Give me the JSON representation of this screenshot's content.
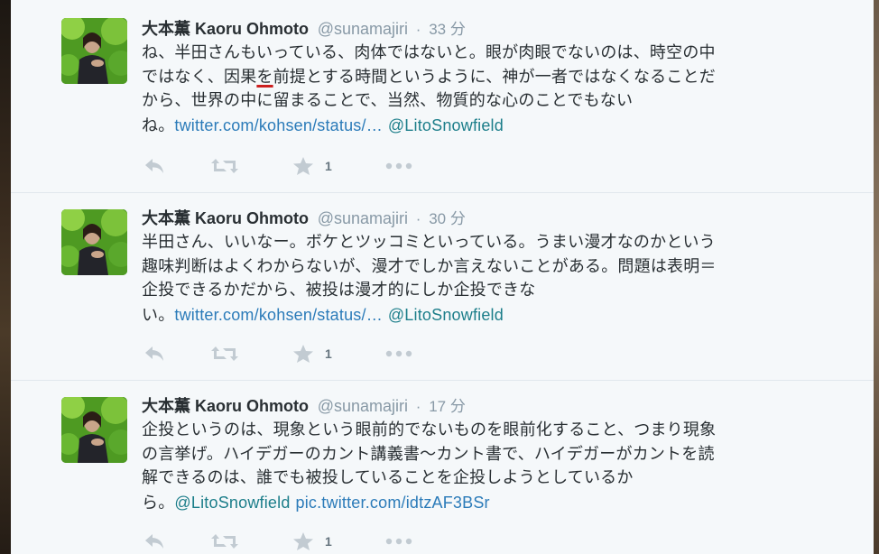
{
  "tweets": [
    {
      "fullname": "大本薫 Kaoru Ohmoto",
      "username": "@sunamajiri",
      "dot": "·",
      "time": "33 分",
      "lines": [
        {
          "a": "ね、半田さんもいっている、肉体ではないと。眼が肉眼でないのは、時空の中"
        },
        {
          "a": "ではなく、因果",
          "typo": "を",
          "b": "前提とする時間というように、神が一者ではなくなることだ"
        },
        {
          "a": "から、世界の中に留まることで、当然、物質的な心のことでもない"
        },
        {
          "a": "ね。",
          "link": "twitter.com/kohsen/status/…",
          "mention": "@LitoSnowfield"
        }
      ],
      "fav_count": "1"
    },
    {
      "fullname": "大本薫 Kaoru Ohmoto",
      "username": "@sunamajiri",
      "dot": "·",
      "time": "30 分",
      "lines": [
        {
          "a": "半田さん、いいなー。ボケとツッコミといっている。うまい漫才なのかという"
        },
        {
          "a": "趣味判断はよくわからないが、漫才でしか言えないことがある。問題は表明＝"
        },
        {
          "a": "企投できるかだから、被投は漫才的にしか企投できな"
        },
        {
          "a": "い。",
          "link": "twitter.com/kohsen/status/…",
          "mention": "@LitoSnowfield"
        }
      ],
      "fav_count": "1"
    },
    {
      "fullname": "大本薫 Kaoru Ohmoto",
      "username": "@sunamajiri",
      "dot": "·",
      "time": "17 分",
      "lines": [
        {
          "a": "企投というのは、現象という眼前的でないものを眼前化すること、つまり現象"
        },
        {
          "a": "の言挙げ。ハイデガーのカント講義書〜カント書で、ハイデガーがカントを読"
        },
        {
          "a": "解できるのは、誰でも被投していることを企投しようとしているか"
        },
        {
          "a": "ら。",
          "mention": "@LitoSnowfield",
          "link": "pic.twitter.com/idtzAF3BSr"
        }
      ],
      "fav_count": "1"
    }
  ],
  "icons": {
    "reply": "reply-icon",
    "retweet": "retweet-icon",
    "favorite": "star-icon",
    "more": "more-icon"
  },
  "colors": {
    "name": "#292f33",
    "meta": "#8899a6",
    "link": "#2b7bb9",
    "typo_underline": "#cc1f1f"
  }
}
